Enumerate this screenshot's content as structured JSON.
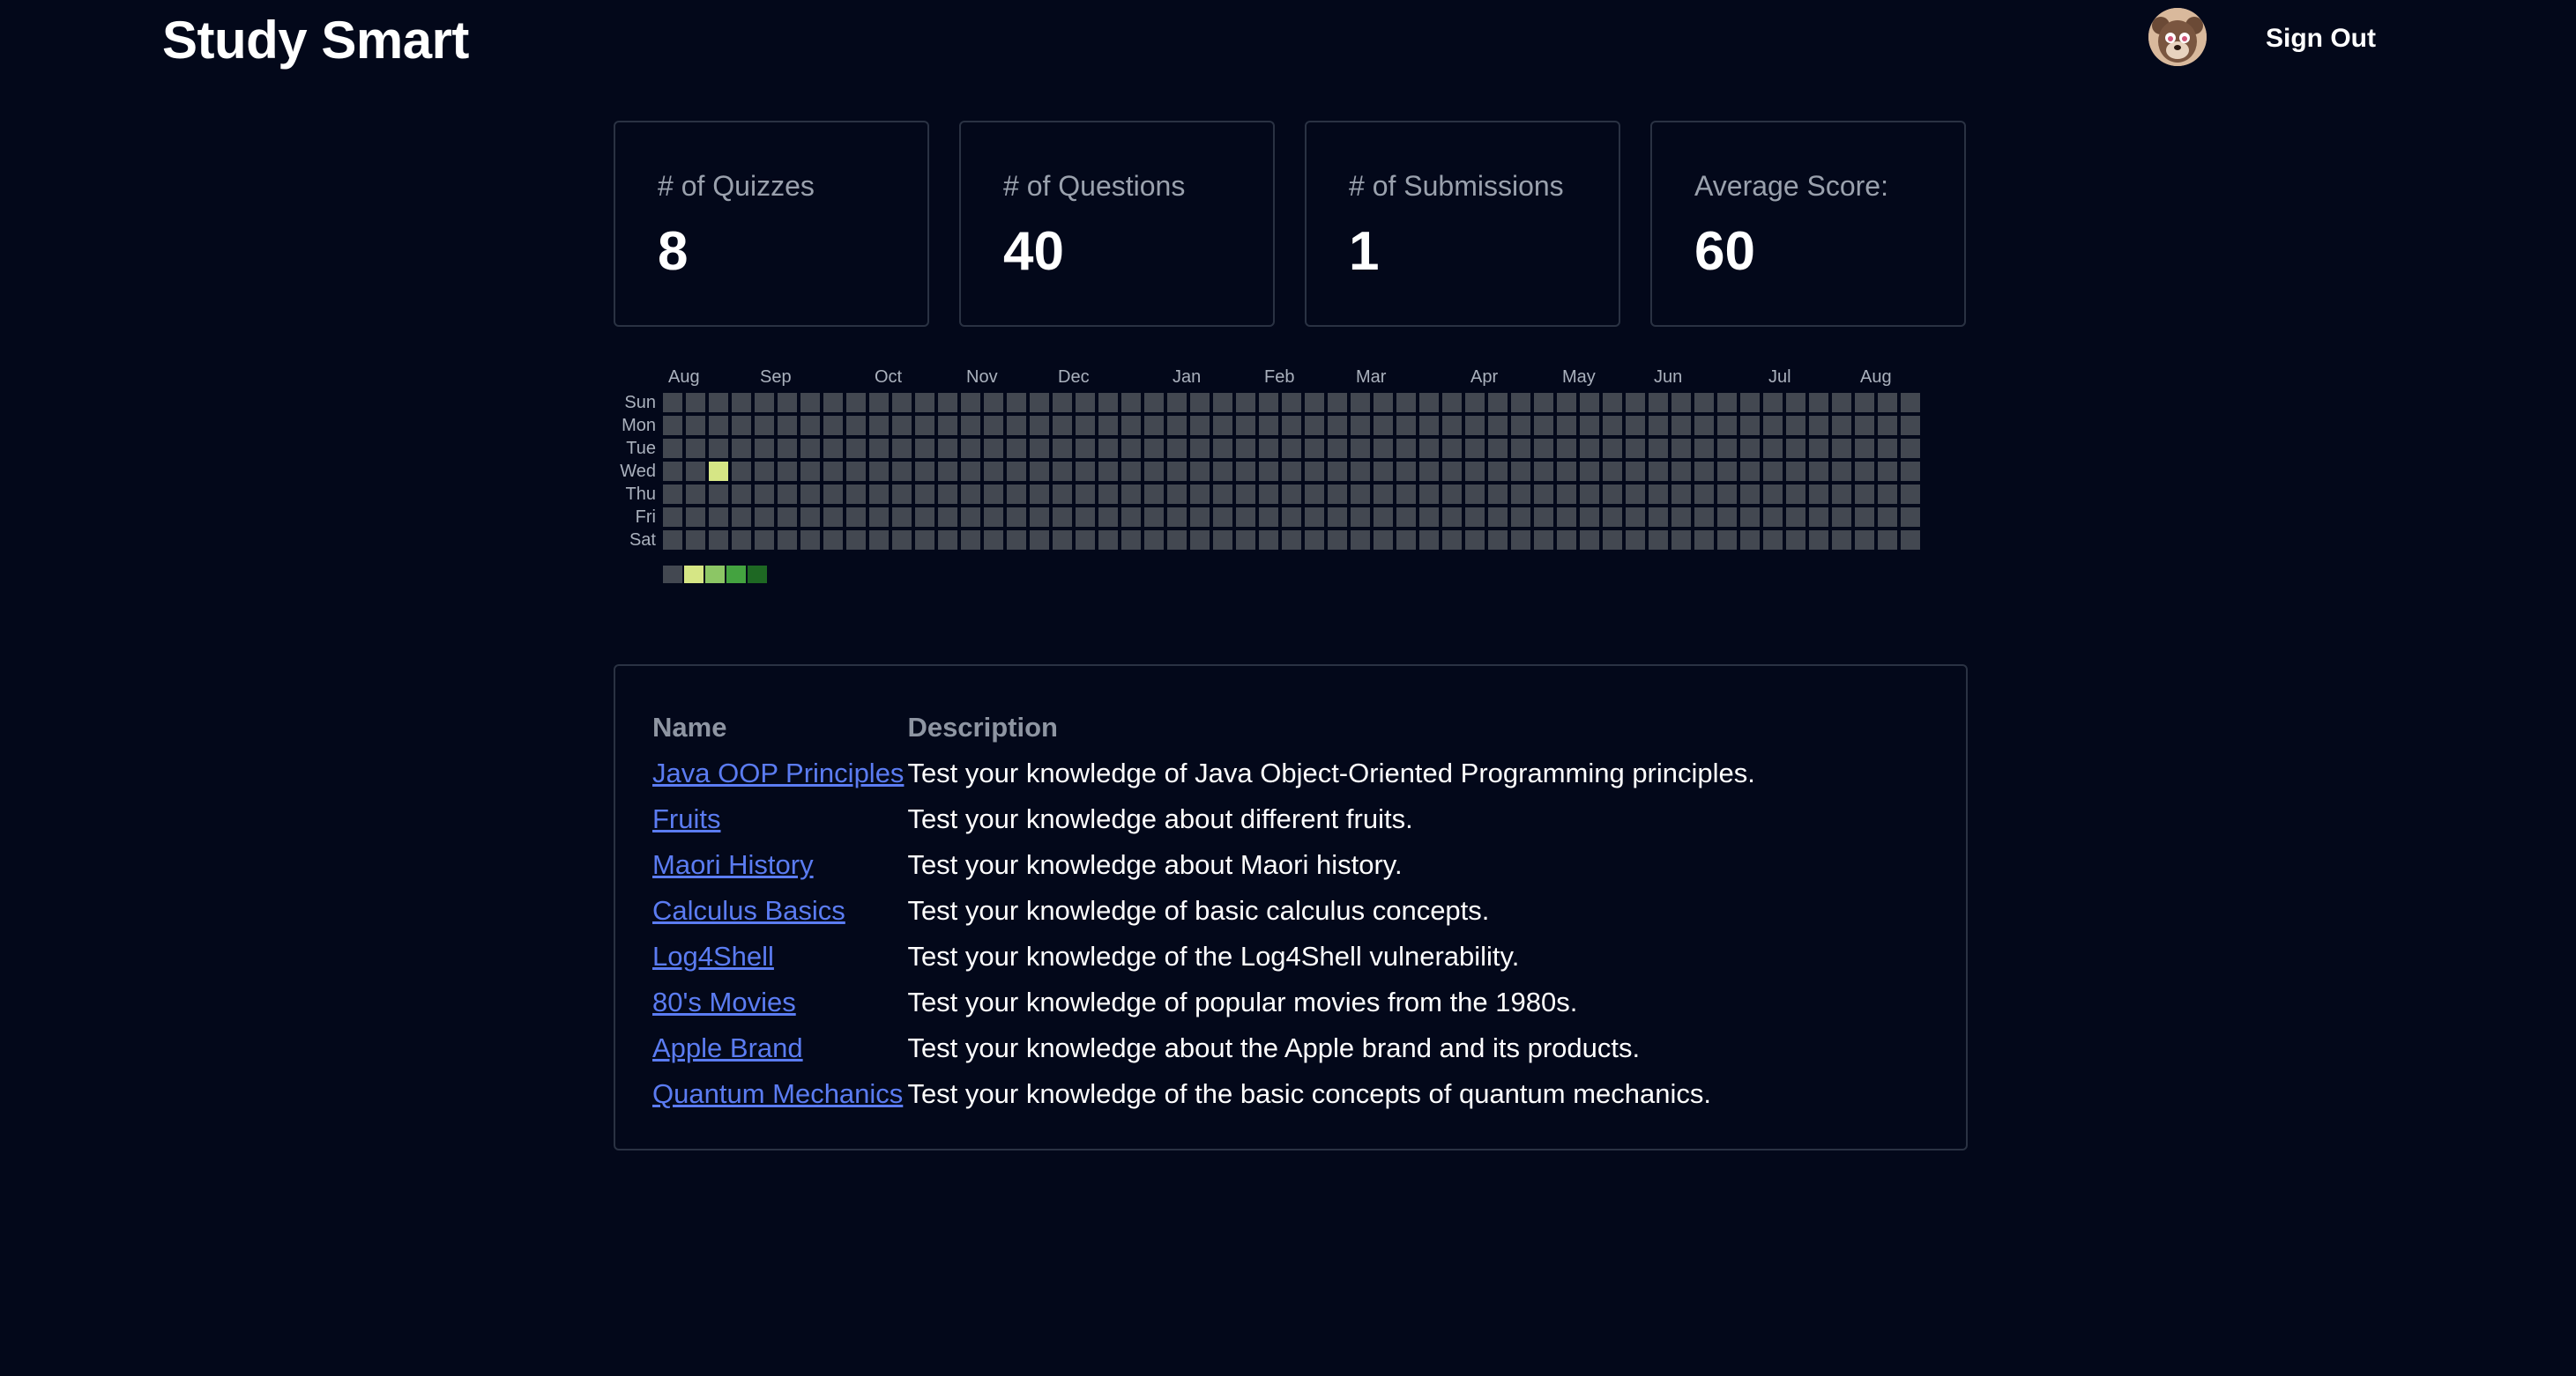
{
  "header": {
    "app_title": "Study Smart",
    "sign_out_label": "Sign Out"
  },
  "stats": [
    {
      "label": "# of Quizzes",
      "value": "8"
    },
    {
      "label": "# of Questions",
      "value": "40"
    },
    {
      "label": "# of Submissions",
      "value": "1"
    },
    {
      "label": "Average Score:",
      "value": "60"
    }
  ],
  "activity_heatmap": {
    "day_labels": [
      "Sun",
      "Mon",
      "Tue",
      "Wed",
      "Thu",
      "Fri",
      "Sat"
    ],
    "month_labels": [
      {
        "label": "Aug",
        "week": 0
      },
      {
        "label": "Sep",
        "week": 4
      },
      {
        "label": "Oct",
        "week": 9
      },
      {
        "label": "Nov",
        "week": 13
      },
      {
        "label": "Dec",
        "week": 17
      },
      {
        "label": "Jan",
        "week": 22
      },
      {
        "label": "Feb",
        "week": 26
      },
      {
        "label": "Mar",
        "week": 30
      },
      {
        "label": "Apr",
        "week": 35
      },
      {
        "label": "May",
        "week": 39
      },
      {
        "label": "Jun",
        "week": 43
      },
      {
        "label": "Jul",
        "week": 48
      },
      {
        "label": "Aug",
        "week": 52
      }
    ],
    "week_count": 55,
    "active_cells": [
      {
        "week": 2,
        "day": 3,
        "level": 1
      }
    ],
    "legend_colors": [
      "#434851",
      "#d6e685",
      "#8cc665",
      "#44a340",
      "#1e6823"
    ],
    "empty_color": "#434851",
    "label_color": "#aab1bd"
  },
  "quizzes": {
    "columns": [
      "Name",
      "Description"
    ],
    "rows": [
      {
        "name": "Java OOP Principles",
        "description": "Test your knowledge of Java Object-Oriented Programming principles."
      },
      {
        "name": "Fruits",
        "description": "Test your knowledge about different fruits."
      },
      {
        "name": "Maori History",
        "description": "Test your knowledge about Maori history."
      },
      {
        "name": "Calculus Basics",
        "description": "Test your knowledge of basic calculus concepts."
      },
      {
        "name": "Log4Shell",
        "description": "Test your knowledge of the Log4Shell vulnerability."
      },
      {
        "name": "80's Movies",
        "description": "Test your knowledge of popular movies from the 1980s."
      },
      {
        "name": "Apple Brand",
        "description": "Test your knowledge about the Apple brand and its products."
      },
      {
        "name": "Quantum Mechanics",
        "description": "Test your knowledge of the basic concepts of quantum mechanics."
      }
    ]
  },
  "colors": {
    "background": "#03081a",
    "link": "#5b7cf2",
    "card_border": "#2a3243"
  }
}
